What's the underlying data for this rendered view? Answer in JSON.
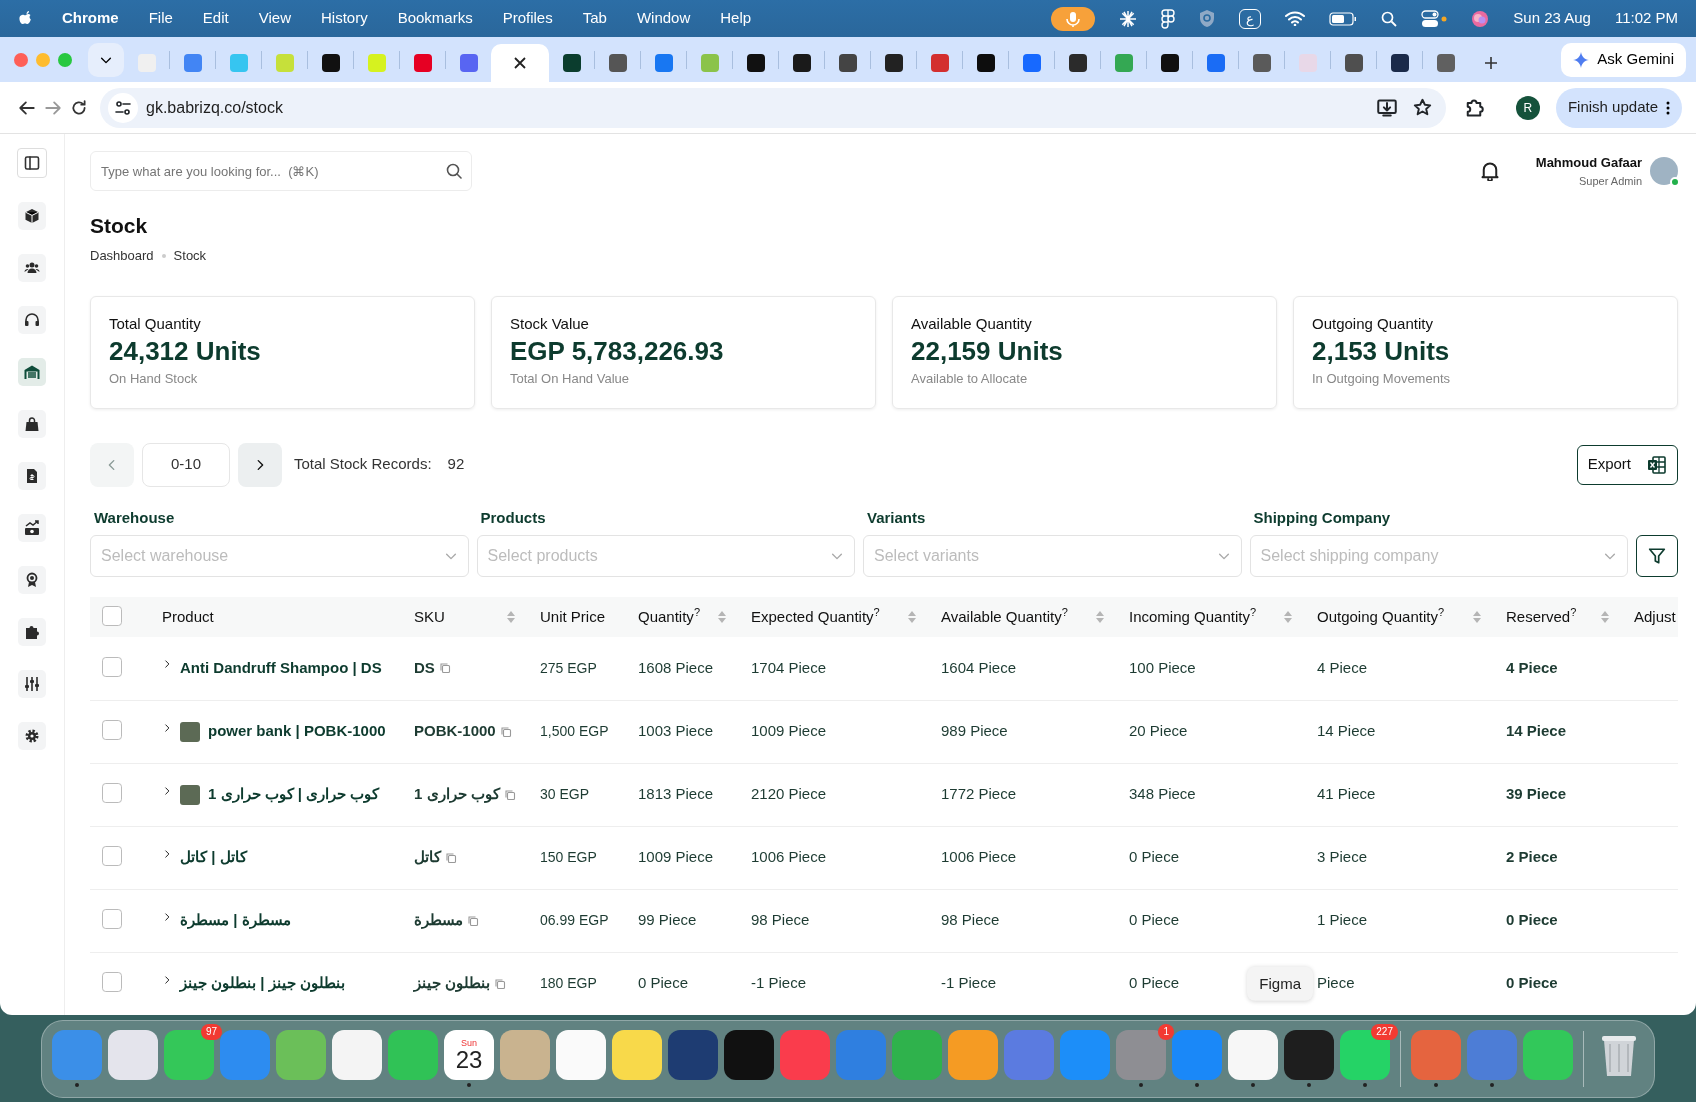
{
  "menu_bar": {
    "app": "Chrome",
    "menus": [
      "File",
      "Edit",
      "View",
      "History",
      "Bookmarks",
      "Profiles",
      "Tab",
      "Window",
      "Help"
    ],
    "input_source": "ع",
    "date": "Sun 23 Aug",
    "time": "11:02 PM"
  },
  "browser": {
    "tabs": [
      {
        "color": "#f0f0f0",
        "selected": false
      },
      {
        "color": "#4285f4",
        "selected": false
      },
      {
        "color": "#36c5f0",
        "selected": false
      },
      {
        "color": "#c6e03a",
        "selected": false
      },
      {
        "color": "#111111",
        "selected": false
      },
      {
        "color": "#d6f21f",
        "selected": false
      },
      {
        "color": "#e60023",
        "selected": false
      },
      {
        "color": "#5865f2",
        "selected": false
      },
      {
        "selected": true
      },
      {
        "color": "#0b3d2e",
        "selected": false
      },
      {
        "color": "#555555",
        "selected": false
      },
      {
        "color": "#1877f2",
        "selected": false
      },
      {
        "color": "#8bc34a",
        "selected": false
      },
      {
        "color": "#111111",
        "selected": false
      },
      {
        "color": "#1a1a1a",
        "selected": false
      },
      {
        "color": "#444444",
        "selected": false
      },
      {
        "color": "#222222",
        "selected": false
      },
      {
        "color": "#d32f2f",
        "selected": false
      },
      {
        "color": "#0d0d0d",
        "selected": false
      },
      {
        "color": "#1769ff",
        "selected": false
      },
      {
        "color": "#2b2b2b",
        "selected": false
      },
      {
        "color": "#34a853",
        "selected": false
      },
      {
        "color": "#101010",
        "selected": false
      },
      {
        "color": "#1a6cf5",
        "selected": false
      },
      {
        "color": "#5a5a5a",
        "selected": false
      },
      {
        "color": "#e8d8e8",
        "selected": false
      },
      {
        "color": "#4f4f4f",
        "selected": false
      },
      {
        "color": "#1a2a4a",
        "selected": false
      },
      {
        "color": "#606060",
        "selected": false
      }
    ],
    "gemini": "Ask Gemini",
    "url": "gk.babrizq.co/stock",
    "profile": "R",
    "update": "Finish update"
  },
  "sidebar": {
    "items": [
      {
        "selected": false
      },
      {
        "selected": false
      },
      {
        "selected": false
      },
      {
        "selected": true
      },
      {
        "selected": false
      },
      {
        "selected": false
      },
      {
        "selected": false
      },
      {
        "selected": false
      },
      {
        "selected": false
      },
      {
        "selected": false
      },
      {
        "selected": false
      }
    ]
  },
  "header": {
    "search_placeholder": "Type what are you looking for...  (⌘K)",
    "user": {
      "name": "Mahmoud Gafaar",
      "role": "Super Admin",
      "online": true
    }
  },
  "page": {
    "title": "Stock",
    "breadcrumb": [
      "Dashboard",
      "Stock"
    ]
  },
  "stats": [
    {
      "label": "Total Quantity",
      "value": "24,312 Units",
      "caption": "On Hand Stock"
    },
    {
      "label": "Stock Value",
      "value": "EGP 5,783,226.93",
      "caption": "Total On Hand Value"
    },
    {
      "label": "Available Quantity",
      "value": "22,159 Units",
      "caption": "Available to Allocate"
    },
    {
      "label": "Outgoing Quantity",
      "value": "2,153 Units",
      "caption": "In Outgoing Movements"
    }
  ],
  "pagination": {
    "range": "0-10",
    "total_label": "Total Stock Records:",
    "total": "92",
    "prev_disabled": true
  },
  "export": "Export",
  "filters": [
    {
      "label": "Warehouse",
      "placeholder": "Select warehouse"
    },
    {
      "label": "Products",
      "placeholder": "Select products"
    },
    {
      "label": "Variants",
      "placeholder": "Select variants"
    },
    {
      "label": "Shipping Company",
      "placeholder": "Select shipping company"
    }
  ],
  "table": {
    "all_checked": false,
    "columns": [
      {
        "label": "Product",
        "sortable": false
      },
      {
        "label": "SKU",
        "sortable": true
      },
      {
        "label": "Unit Price",
        "sortable": false
      },
      {
        "label": "Quantity$^{?}$",
        "sortable": true
      },
      {
        "label": "Expected Quantity$^{?}$",
        "sortable": true
      },
      {
        "label": "Available Quantity$^{?}$",
        "sortable": true
      },
      {
        "label": "Incoming Quantity$^{?}$",
        "sortable": true
      },
      {
        "label": "Outgoing Quantity$^{?}$",
        "sortable": true
      },
      {
        "label": "Reserved$^{?}$",
        "sortable": true
      },
      {
        "label": "Adjust",
        "sortable": false
      }
    ],
    "rows": [
      {
        "checked": false,
        "thumbnail": false,
        "cells": [
          "Anti Dandruff Shampoo | DS",
          "DS",
          "275 EGP",
          "1608 Piece",
          "1704 Piece",
          "1604 Piece",
          "100 Piece",
          "4 Piece",
          "4 Piece"
        ]
      },
      {
        "checked": false,
        "thumbnail": true,
        "cells": [
          "power bank | POBK-1000",
          "POBK-1000",
          "1,500 EGP",
          "1003 Piece",
          "1009 Piece",
          "989 Piece",
          "20 Piece",
          "14 Piece",
          "14 Piece"
        ]
      },
      {
        "checked": false,
        "thumbnail": true,
        "cells": [
          "كوب حرارى | كوب حرارى 1",
          "كوب حرارى 1",
          "30 EGP",
          "1813 Piece",
          "2120 Piece",
          "1772 Piece",
          "348 Piece",
          "41 Piece",
          "39 Piece"
        ]
      },
      {
        "checked": false,
        "thumbnail": false,
        "cells": [
          "كاتل | كاتل",
          "كاتل",
          "150 EGP",
          "1009 Piece",
          "1006 Piece",
          "1006 Piece",
          "0 Piece",
          "3 Piece",
          "2 Piece"
        ]
      },
      {
        "checked": false,
        "thumbnail": false,
        "cells": [
          "مسطرة | مسطرة",
          "مسطرة",
          "06.99 EGP",
          "99 Piece",
          "98 Piece",
          "98 Piece",
          "0 Piece",
          "1 Piece",
          "0 Piece"
        ]
      },
      {
        "checked": false,
        "thumbnail": false,
        "cells": [
          "بنطلون جينز | بنطلون جينز",
          "بنطلون جينز",
          "180 EGP",
          "0 Piece",
          "-1 Piece",
          "-1 Piece",
          "0 Piece",
          "Piece",
          "0 Piece"
        ]
      }
    ]
  },
  "tooltip": "Figma",
  "dock": {
    "sections": [
      [
        {
          "kind": "app",
          "color": "#3b8fe8",
          "running": true
        },
        {
          "kind": "app",
          "color": "#e4e4ec",
          "running": false
        },
        {
          "kind": "app",
          "color": "#34c759",
          "running": false,
          "badge": "97"
        },
        {
          "kind": "app",
          "color": "#2d8cf0",
          "running": false
        },
        {
          "kind": "app",
          "color": "#6bbf59",
          "running": false
        },
        {
          "kind": "app",
          "color": "#f4f4f4",
          "running": false
        },
        {
          "kind": "app",
          "color": "#30c256",
          "running": false
        },
        {
          "kind": "calendar",
          "color": "#ffffff",
          "running": true,
          "weekday": "Sun",
          "day": "23"
        },
        {
          "kind": "app",
          "color": "#c9b38f",
          "running": false
        },
        {
          "kind": "app",
          "color": "#fafafa",
          "running": false
        },
        {
          "kind": "app",
          "color": "#f8d94a",
          "running": false
        },
        {
          "kind": "app",
          "color": "#1e3c72",
          "running": false
        },
        {
          "kind": "app",
          "color": "#111111",
          "running": false
        },
        {
          "kind": "app",
          "color": "#fa3c4c",
          "running": false
        },
        {
          "kind": "app",
          "color": "#2f7fe0",
          "running": false
        },
        {
          "kind": "app",
          "color": "#2fb24c",
          "running": false
        },
        {
          "kind": "app",
          "color": "#f59b23",
          "running": false
        },
        {
          "kind": "app",
          "color": "#5b7be0",
          "running": false
        },
        {
          "kind": "app",
          "color": "#1c8ef9",
          "running": false
        },
        {
          "kind": "app",
          "color": "#8e8e93",
          "running": true,
          "badge": "1"
        },
        {
          "kind": "app",
          "color": "#1a88f8",
          "running": true
        },
        {
          "kind": "app",
          "color": "#f7f7f7",
          "running": true
        },
        {
          "kind": "app",
          "color": "#1e1e1e",
          "running": true
        },
        {
          "kind": "app",
          "color": "#25d366",
          "running": true,
          "badge": "227"
        }
      ],
      [
        {
          "kind": "app",
          "color": "#e5643f",
          "running": true
        },
        {
          "kind": "app",
          "color": "#4d7dd6",
          "running": true
        },
        {
          "kind": "app",
          "color": "#32c85a",
          "running": false
        }
      ],
      [
        {
          "kind": "trash",
          "color": "#d0d4d8",
          "running": false
        }
      ]
    ]
  }
}
